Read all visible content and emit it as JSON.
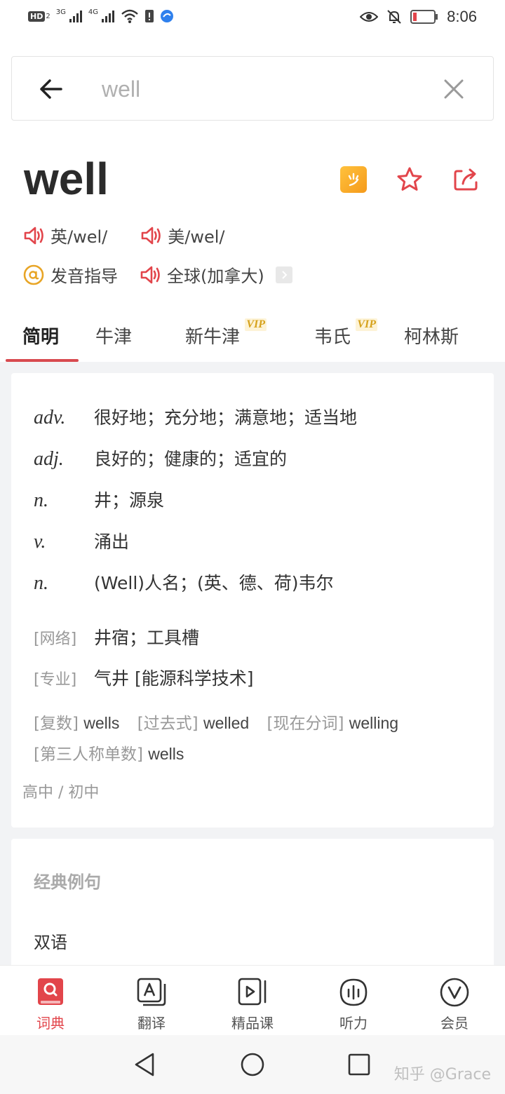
{
  "status_bar": {
    "left_badge": "HD",
    "left_badge_sub": "2",
    "net1": "3G",
    "net2": "4G",
    "time": "8:06"
  },
  "search": {
    "query": "well"
  },
  "entry": {
    "word": "well",
    "pronunciations": [
      {
        "label": "英/wel/"
      },
      {
        "label": "美/wel/"
      }
    ],
    "guide_label": "发音指导",
    "global_label": "全球(加拿大)"
  },
  "tabs": [
    {
      "label": "简明",
      "active": true
    },
    {
      "label": "牛津"
    },
    {
      "label": "新牛津",
      "vip": "VIP"
    },
    {
      "label": "韦氏",
      "vip": "VIP"
    },
    {
      "label": "柯林斯"
    }
  ],
  "definitions": [
    {
      "pos": "adv.",
      "meaning": "很好地；充分地；满意地；适当地"
    },
    {
      "pos": "adj.",
      "meaning": "良好的；健康的；适宜的"
    },
    {
      "pos": "n.",
      "meaning": "井；源泉"
    },
    {
      "pos": "v.",
      "meaning": "涌出"
    },
    {
      "pos": "n.",
      "meaning": "(Well)人名；(英、德、荷)韦尔"
    }
  ],
  "extra": [
    {
      "tag": "[网络]",
      "meaning": "井宿；工具槽"
    },
    {
      "tag": "[专业]",
      "meaning": "气井 [能源科学技术]"
    }
  ],
  "forms": [
    {
      "label": "[复数]",
      "value": "wells"
    },
    {
      "label": "[过去式]",
      "value": "welled"
    },
    {
      "label": "[现在分词]",
      "value": "welling"
    },
    {
      "label": "[第三人称单数]",
      "value": "wells"
    }
  ],
  "level": "高中 / 初中",
  "examples": {
    "title": "经典例句",
    "subtitle": "双语"
  },
  "bottom_nav": [
    {
      "label": "词典",
      "active": true
    },
    {
      "label": "翻译"
    },
    {
      "label": "精品课"
    },
    {
      "label": "听力"
    },
    {
      "label": "会员"
    }
  ],
  "watermark": "知乎 @Grace",
  "colors": {
    "accent": "#e2454b",
    "tab_underline": "#d84a4f",
    "vip": "#d6a21c",
    "badge": "#f5a623"
  }
}
